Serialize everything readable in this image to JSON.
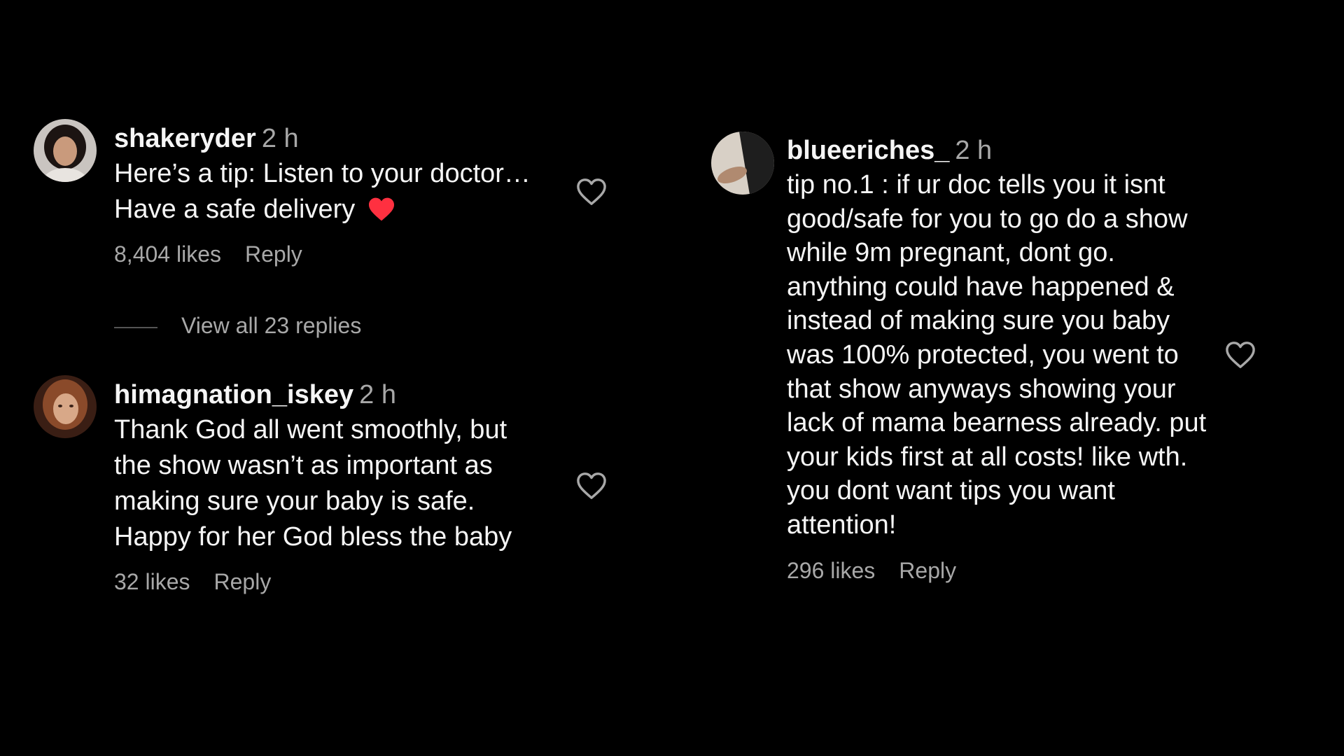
{
  "comments": [
    {
      "username": "shakeryder",
      "time": "2 h",
      "lines": [
        "Here’s a tip: Listen to your doctor…",
        "Have a safe delivery"
      ],
      "emoji": "red-heart-emoji",
      "likes": "8,404 likes",
      "reply": "Reply",
      "view_replies": "View all 23 replies"
    },
    {
      "username": "himagnation_iskey",
      "time": "2 h",
      "lines": [
        "Thank God all went smoothly, but",
        "the show wasn’t as important as",
        "making sure your baby is safe.",
        "Happy for her God bless the baby"
      ],
      "likes": "32 likes",
      "reply": "Reply"
    },
    {
      "username": "blueeriches_",
      "time": "2 h",
      "lines": [
        "tip no.1 : if ur doc tells you it isnt",
        "good/safe for you to go do a show",
        "while 9m pregnant, dont go.",
        "anything could have happened &",
        "instead of making sure you baby",
        "was 100% protected, you went to",
        "that show anyways showing your",
        "lack of mama bearness already. put",
        "your kids first at all costs! like wth.",
        "you dont want tips you want",
        "attention!"
      ],
      "likes": "296 likes",
      "reply": "Reply"
    }
  ],
  "colors": {
    "background": "#000000",
    "text": "#f5f5f5",
    "secondary": "#a8a8a8",
    "heart_red": "#ff3040"
  },
  "icons": {
    "like": "heart-outline-icon",
    "emoji": "red-heart-emoji"
  }
}
